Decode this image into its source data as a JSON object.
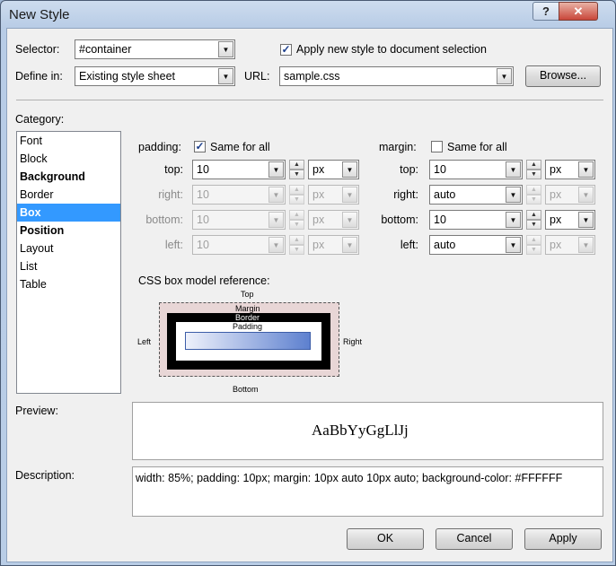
{
  "window": {
    "title": "New Style"
  },
  "selector": {
    "label": "Selector:",
    "value": "#container"
  },
  "apply_new_style": {
    "label": "Apply new style to document selection",
    "checked": true
  },
  "define_in": {
    "label": "Define in:",
    "value": "Existing style sheet"
  },
  "url": {
    "label": "URL:",
    "value": "sample.css"
  },
  "browse_label": "Browse...",
  "category": {
    "label": "Category:",
    "items": [
      {
        "label": "Font",
        "bold": false,
        "selected": false
      },
      {
        "label": "Block",
        "bold": false,
        "selected": false
      },
      {
        "label": "Background",
        "bold": true,
        "selected": false
      },
      {
        "label": "Border",
        "bold": false,
        "selected": false
      },
      {
        "label": "Box",
        "bold": true,
        "selected": true
      },
      {
        "label": "Position",
        "bold": true,
        "selected": false
      },
      {
        "label": "Layout",
        "bold": false,
        "selected": false
      },
      {
        "label": "List",
        "bold": false,
        "selected": false
      },
      {
        "label": "Table",
        "bold": false,
        "selected": false
      }
    ]
  },
  "padding": {
    "label": "padding:",
    "same_for_all": {
      "label": "Same for all",
      "checked": true
    },
    "rows": [
      {
        "label": "top:",
        "value": "10",
        "unit": "px",
        "enabled": true
      },
      {
        "label": "right:",
        "value": "10",
        "unit": "px",
        "enabled": false
      },
      {
        "label": "bottom:",
        "value": "10",
        "unit": "px",
        "enabled": false
      },
      {
        "label": "left:",
        "value": "10",
        "unit": "px",
        "enabled": false
      }
    ]
  },
  "margin": {
    "label": "margin:",
    "same_for_all": {
      "label": "Same for all",
      "checked": false
    },
    "rows": [
      {
        "label": "top:",
        "value": "10",
        "unit": "px",
        "unit_enabled": true
      },
      {
        "label": "right:",
        "value": "auto",
        "unit": "px",
        "unit_enabled": false
      },
      {
        "label": "bottom:",
        "value": "10",
        "unit": "px",
        "unit_enabled": true
      },
      {
        "label": "left:",
        "value": "auto",
        "unit": "px",
        "unit_enabled": false
      }
    ]
  },
  "box_model": {
    "label": "CSS box model reference:",
    "top": "Top",
    "bottom": "Bottom",
    "left": "Left",
    "right": "Right",
    "margin": "Margin",
    "border": "Border",
    "padding": "Padding"
  },
  "preview": {
    "label": "Preview:",
    "sample": "AaBbYyGgLlJj"
  },
  "description": {
    "label": "Description:",
    "text": "width: 85%; padding: 10px; margin: 10px auto 10px auto; background-color: #FFFFFF"
  },
  "buttons": {
    "ok": "OK",
    "cancel": "Cancel",
    "apply": "Apply"
  }
}
